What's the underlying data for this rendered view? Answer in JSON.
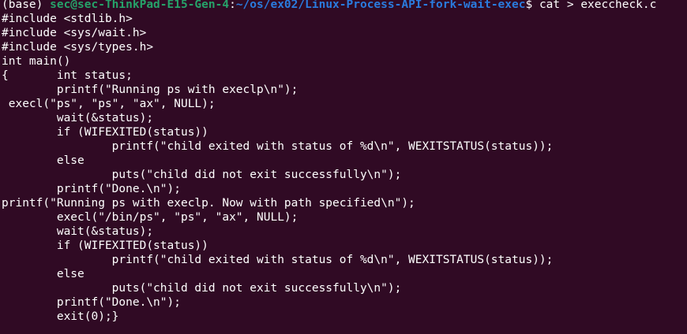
{
  "window": {
    "type": "terminal",
    "background": "#300a24",
    "foreground": "#ffffff",
    "user_color": "#26a269",
    "path_color": "#2a7bde"
  },
  "prompt": {
    "env": "(base) ",
    "user_host": "sec@sec-ThinkPad-E15-Gen-4",
    "sep": ":",
    "path": "~/os/ex02/Linux-Process-API-fork-wait-exec",
    "symbol": "$ ",
    "command": "cat > execcheck.c"
  },
  "code_lines": [
    "#include <stdlib.h>",
    "#include <sys/wait.h>",
    "#include <sys/types.h>",
    "int main()",
    "{       int status;",
    "        printf(\"Running ps with execlp\\n\");",
    " execl(\"ps\", \"ps\", \"ax\", NULL);",
    "        wait(&status);",
    "        if (WIFEXITED(status))",
    "                printf(\"child exited with status of %d\\n\", WEXITSTATUS(status));",
    "        else",
    "                puts(\"child did not exit successfully\\n\");",
    "        printf(\"Done.\\n\");",
    "printf(\"Running ps with execlp. Now with path specified\\n\");",
    "        execl(\"/bin/ps\", \"ps\", \"ax\", NULL);",
    "        wait(&status);",
    "        if (WIFEXITED(status))",
    "                printf(\"child exited with status of %d\\n\", WEXITSTATUS(status));",
    "        else",
    "                puts(\"child did not exit successfully\\n\");",
    "        printf(\"Done.\\n\");",
    "        exit(0);}"
  ]
}
